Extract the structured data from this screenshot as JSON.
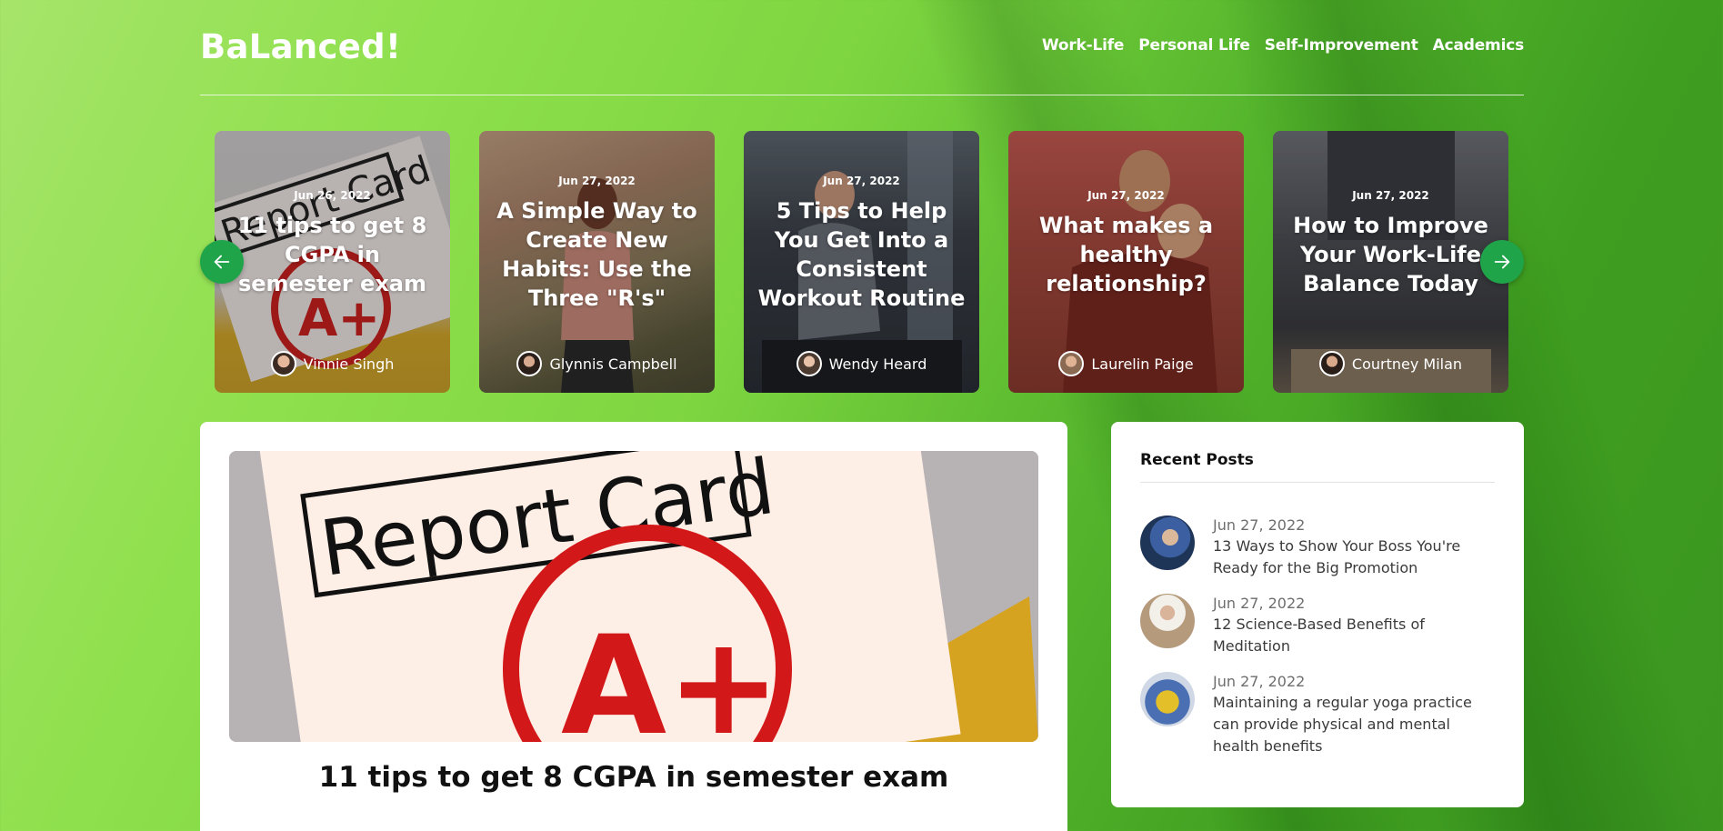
{
  "brand": {
    "logo": "BaLanced!"
  },
  "nav": {
    "items": [
      "Work-Life",
      "Personal Life",
      "Self-Improvement",
      "Academics"
    ]
  },
  "carousel": {
    "cards": [
      {
        "date": "Jun 26, 2022",
        "title": "11 tips to get 8 CGPA in semester exam",
        "author": "Vinnie Singh"
      },
      {
        "date": "Jun 27, 2022",
        "title": "A Simple Way to Create New Habits: Use the Three \"R's\"",
        "author": "Glynnis Campbell"
      },
      {
        "date": "Jun 27, 2022",
        "title": "5 Tips to Help You Get Into a Consistent Workout Routine",
        "author": "Wendy Heard"
      },
      {
        "date": "Jun 27, 2022",
        "title": "What makes a healthy relationship?",
        "author": "Laurelin Paige"
      },
      {
        "date": "Jun 27, 2022",
        "title": "How to Improve Your Work-Life Balance Today",
        "author": "Courtney Milan"
      }
    ],
    "hero_image_text": "Report Card",
    "grade": "A+"
  },
  "article": {
    "title": "11 tips to get 8 CGPA in semester exam"
  },
  "recent": {
    "heading": "Recent Posts",
    "posts": [
      {
        "date": "Jun 27, 2022",
        "title": "13 Ways to Show Your Boss You're Ready for the Big Promotion"
      },
      {
        "date": "Jun 27, 2022",
        "title": "12 Science-Based Benefits of Meditation"
      },
      {
        "date": "Jun 27, 2022",
        "title": "Maintaining a regular yoga practice can provide physical and mental health benefits"
      }
    ]
  },
  "colors": {
    "accent": "#1fa449",
    "background": "#7dd540"
  }
}
